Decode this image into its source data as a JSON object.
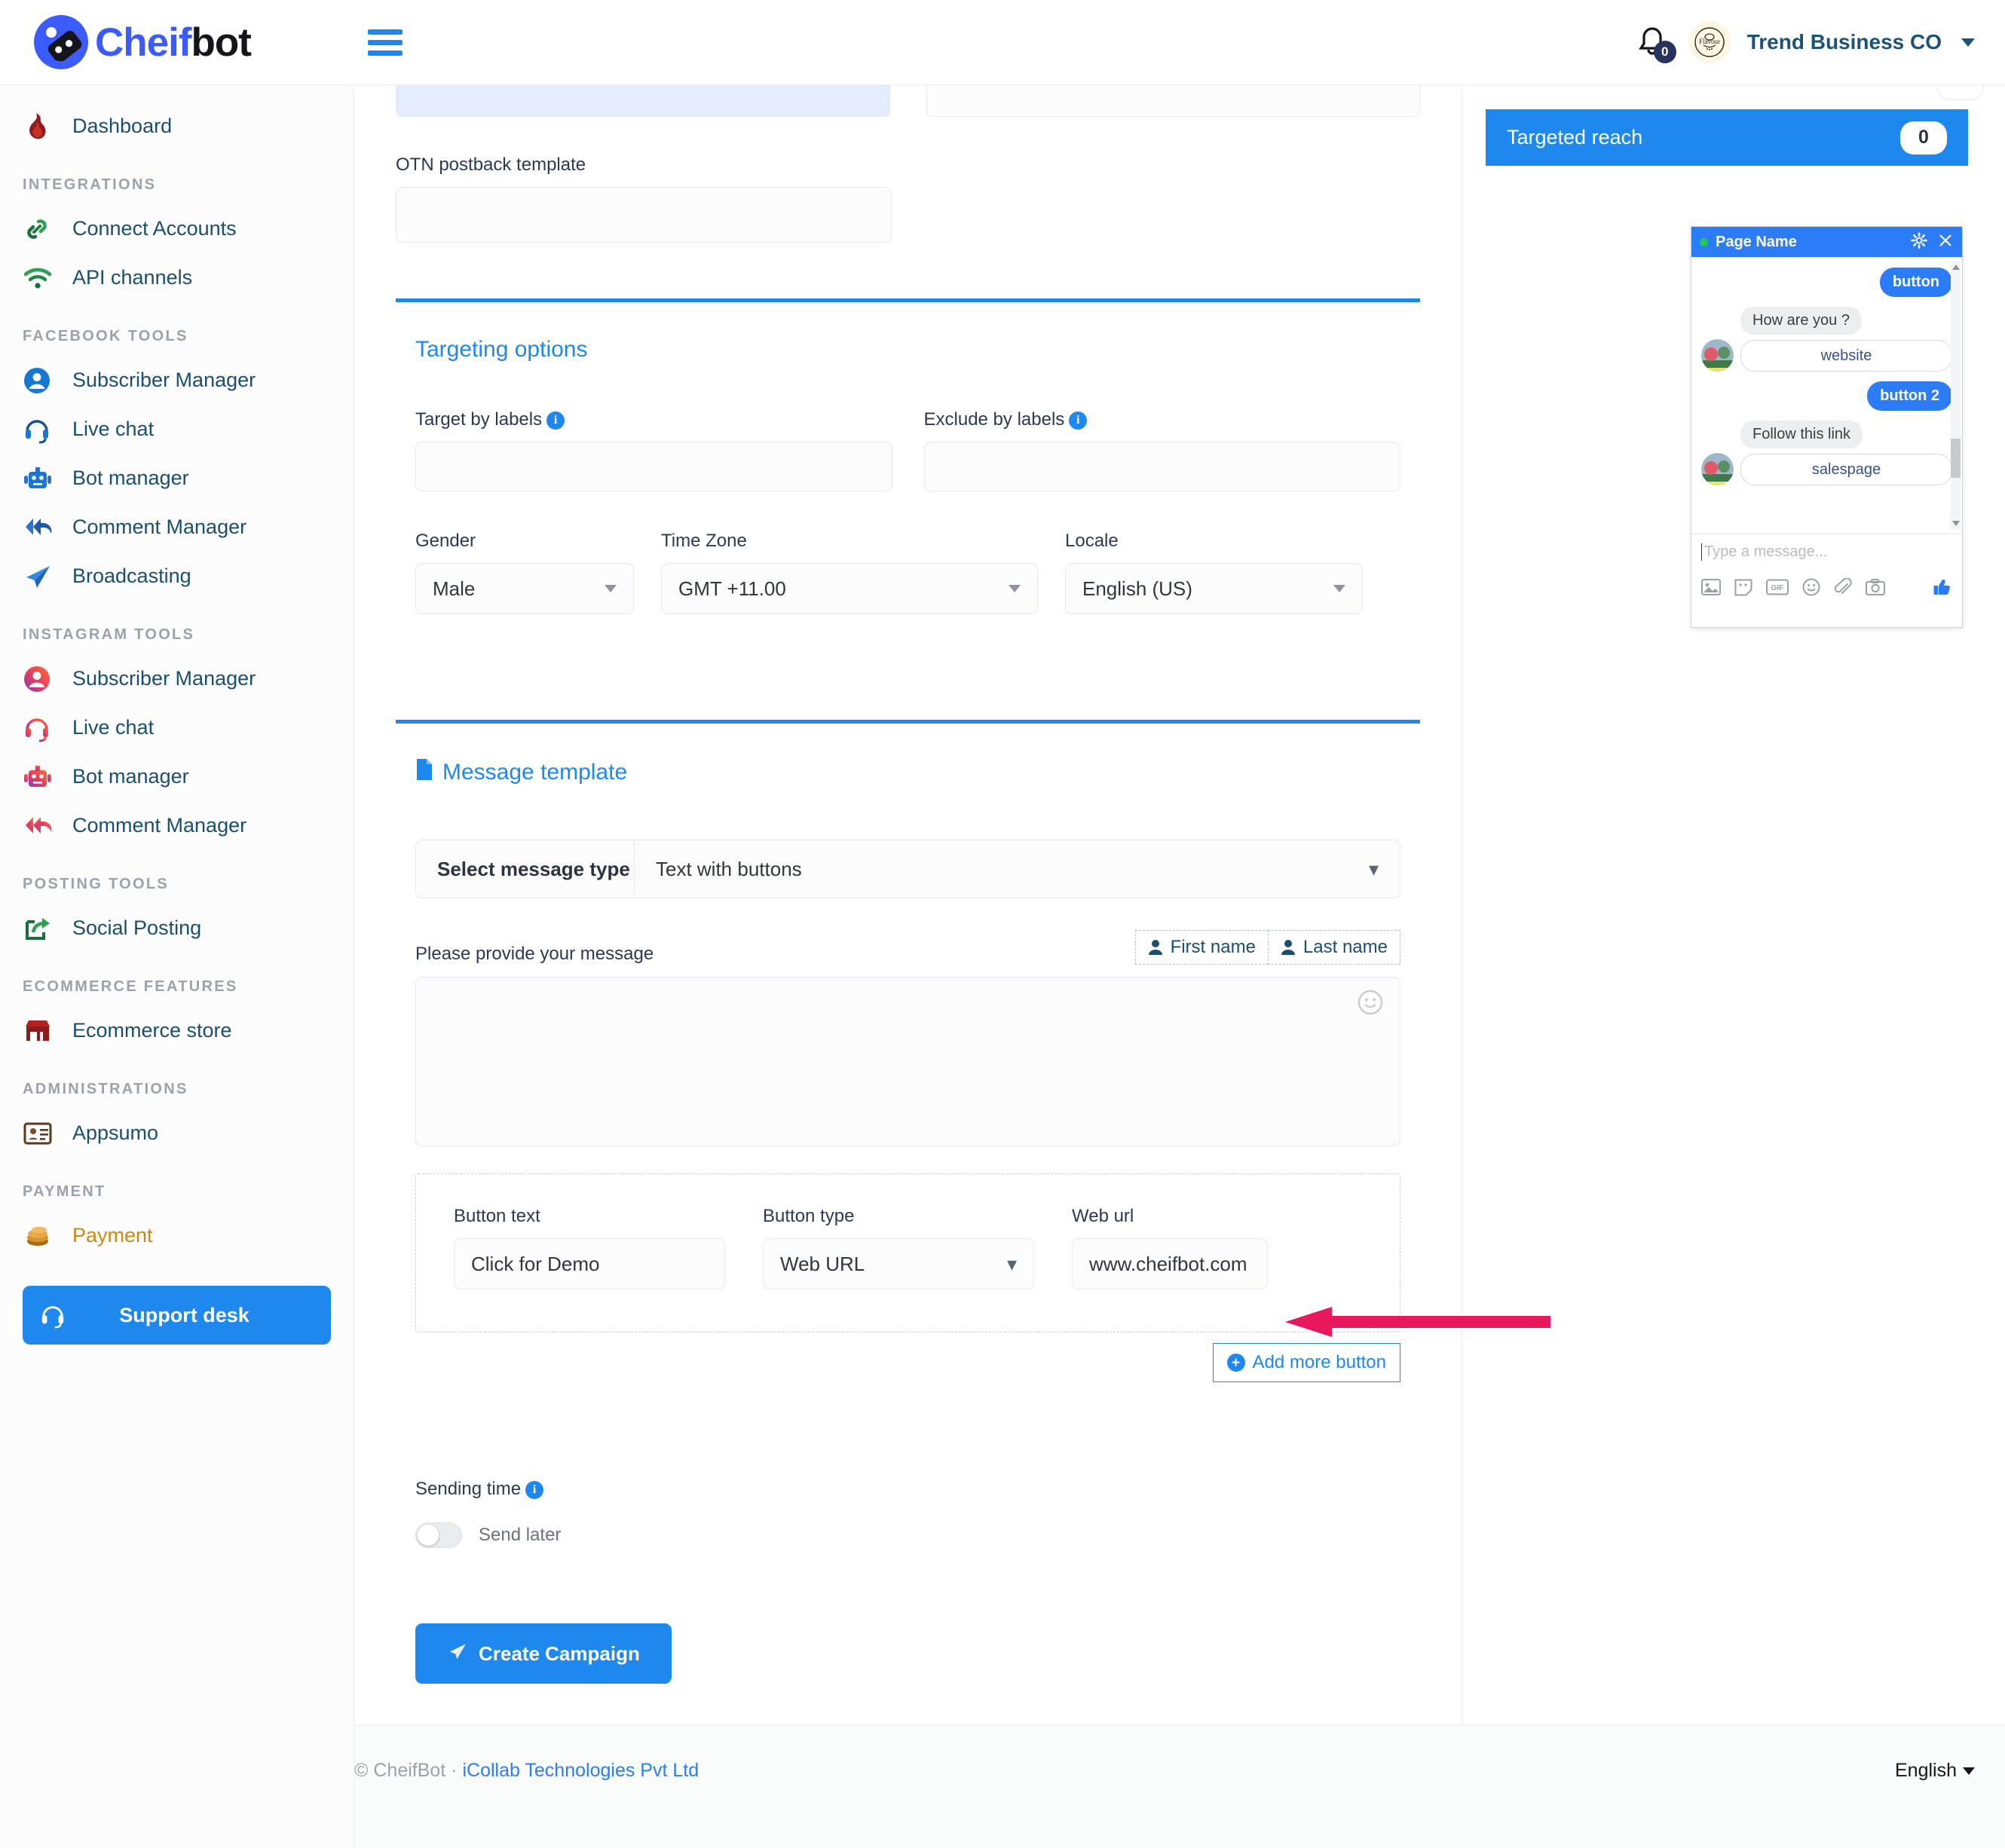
{
  "brand": {
    "part1": "Cheif",
    "part2": "bot"
  },
  "topbar": {
    "hamburger_icon": "hamburger-menu-icon",
    "notification_count": "0",
    "user_name": "Trend Business CO",
    "avatar_label": "Flavour"
  },
  "sidebar": {
    "dashboard": {
      "label": "Dashboard",
      "icon": "flame-icon"
    },
    "groups": [
      {
        "title": "INTEGRATIONS",
        "items": [
          {
            "label": "Connect Accounts",
            "icon": "link-icon"
          },
          {
            "label": "API channels",
            "icon": "wifi-icon"
          }
        ]
      },
      {
        "title": "FACEBOOK TOOLS",
        "items": [
          {
            "label": "Subscriber Manager",
            "icon": "user-circle-icon"
          },
          {
            "label": "Live chat",
            "icon": "headset-icon"
          },
          {
            "label": "Bot manager",
            "icon": "robot-icon"
          },
          {
            "label": "Comment Manager",
            "icon": "reply-all-icon"
          },
          {
            "label": "Broadcasting",
            "icon": "paper-plane-icon"
          }
        ]
      },
      {
        "title": "INSTAGRAM TOOLS",
        "items": [
          {
            "label": "Subscriber Manager",
            "icon": "user-circle-icon"
          },
          {
            "label": "Live chat",
            "icon": "headset-icon"
          },
          {
            "label": "Bot manager",
            "icon": "robot-icon"
          },
          {
            "label": "Comment Manager",
            "icon": "reply-all-icon"
          }
        ]
      },
      {
        "title": "POSTING TOOLS",
        "items": [
          {
            "label": "Social Posting",
            "icon": "share-square-icon"
          }
        ]
      },
      {
        "title": "ECOMMERCE FEATURES",
        "items": [
          {
            "label": "Ecommerce store",
            "icon": "storefront-icon"
          }
        ]
      },
      {
        "title": "ADMINISTRATIONS",
        "items": [
          {
            "label": "Appsumo",
            "icon": "id-card-icon"
          }
        ]
      },
      {
        "title": "PAYMENT",
        "items": [
          {
            "label": "Payment",
            "icon": "coins-icon"
          }
        ]
      }
    ],
    "support_desk": {
      "label": "Support desk",
      "icon": "headset-icon"
    }
  },
  "main": {
    "otn_postback_label": "OTN postback template",
    "otn_postback_value": "",
    "targeting": {
      "title": "Targeting options",
      "target_by_labels": {
        "label": "Target by labels",
        "value": "",
        "info_icon": "info-icon"
      },
      "exclude_by_labels": {
        "label": "Exclude by labels",
        "value": "",
        "info_icon": "info-icon"
      },
      "gender": {
        "label": "Gender",
        "value": "Male"
      },
      "timezone": {
        "label": "Time Zone",
        "value": "GMT +11.00"
      },
      "locale": {
        "label": "Locale",
        "value": "English (US)"
      }
    },
    "message_template": {
      "title": "Message template",
      "title_icon": "document-icon",
      "select_message_type_label": "Select message type",
      "select_message_type_value": "Text with buttons",
      "message_label": "Please provide your message",
      "message_value": "",
      "first_name_chip": "First name",
      "last_name_chip": "Last name",
      "emoji_icon": "emoji-smiley-icon",
      "button_text_label": "Button text",
      "button_text_value": "Click for Demo",
      "button_type_label": "Button type",
      "button_type_value": "Web URL",
      "web_url_label": "Web url",
      "web_url_value": "www.cheifbot.com",
      "add_more_button": "Add more button"
    },
    "sending_time": {
      "label": "Sending time",
      "info_icon": "info-icon",
      "send_later_label": "Send later",
      "send_later_on": false
    },
    "create_campaign": {
      "label": "Create Campaign",
      "icon": "paper-plane-icon"
    }
  },
  "rail": {
    "targeted_reach_label": "Targeted reach",
    "targeted_reach_value": "0",
    "chat_preview": {
      "page_name": "Page Name",
      "gear_icon": "gear-icon",
      "close_icon": "close-icon",
      "messages": [
        {
          "side": "out",
          "text": "button"
        },
        {
          "side": "in",
          "text": "How are you ?",
          "button": "website"
        },
        {
          "side": "out",
          "text": "button 2"
        },
        {
          "side": "in",
          "text": "Follow this link",
          "button": "salespage"
        }
      ],
      "input_placeholder": "Type a message...",
      "footer_icons": [
        "image-icon",
        "sticker-icon",
        "gif-icon",
        "smiley-icon",
        "paperclip-icon",
        "camera-icon",
        "thumbs-up-icon"
      ]
    }
  },
  "annotation": {
    "arrow_color": "#e8185d",
    "points_to": "web-url-input"
  },
  "footer": {
    "copyright": "© CheifBot  ·  ",
    "company": "iCollab Technologies Pvt Ltd",
    "language": "English"
  },
  "colors": {
    "accent": "#1f88ef",
    "sidebar_text": "#1b4f6e",
    "gold": "#c98a14"
  }
}
